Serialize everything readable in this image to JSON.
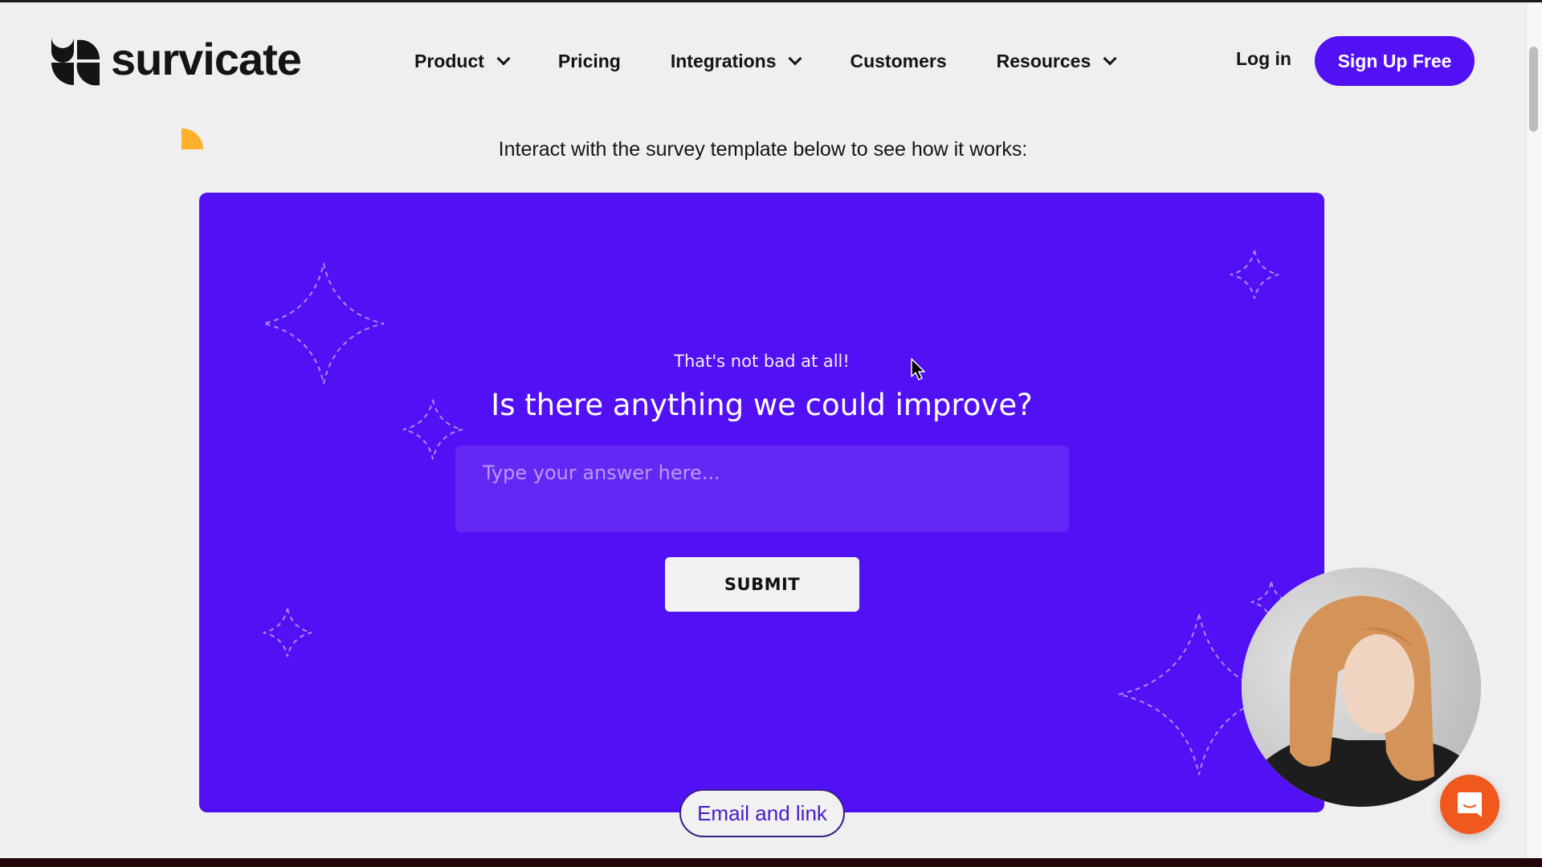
{
  "header": {
    "brand": "survicate",
    "nav": [
      {
        "label": "Product",
        "has_dropdown": true
      },
      {
        "label": "Pricing",
        "has_dropdown": false
      },
      {
        "label": "Integrations",
        "has_dropdown": true
      },
      {
        "label": "Customers",
        "has_dropdown": false
      },
      {
        "label": "Resources",
        "has_dropdown": true
      }
    ],
    "login_label": "Log in",
    "signup_label": "Sign Up Free"
  },
  "intro_text": "Interact with the survey template below to see how it works:",
  "survey": {
    "subtitle": "That's not bad at all!",
    "question": "Is there anything we could improve?",
    "answer_value": "",
    "answer_placeholder": "Type your answer here...",
    "submit_label": "SUBMIT"
  },
  "distribution_tab": "Email and link",
  "icons": {
    "logo": "survicate-logo-icon",
    "chat": "chat-bubble-smile-icon",
    "cursor": "mouse-pointer-icon",
    "dropdown": "chevron-down-icon"
  },
  "colors": {
    "brand_purple": "#5210f5",
    "input_purple": "#6428f5",
    "accent_yellow": "#fdb12b",
    "chat_orange": "#f0581d",
    "page_bg": "#efefef",
    "text_dark": "#141414"
  }
}
